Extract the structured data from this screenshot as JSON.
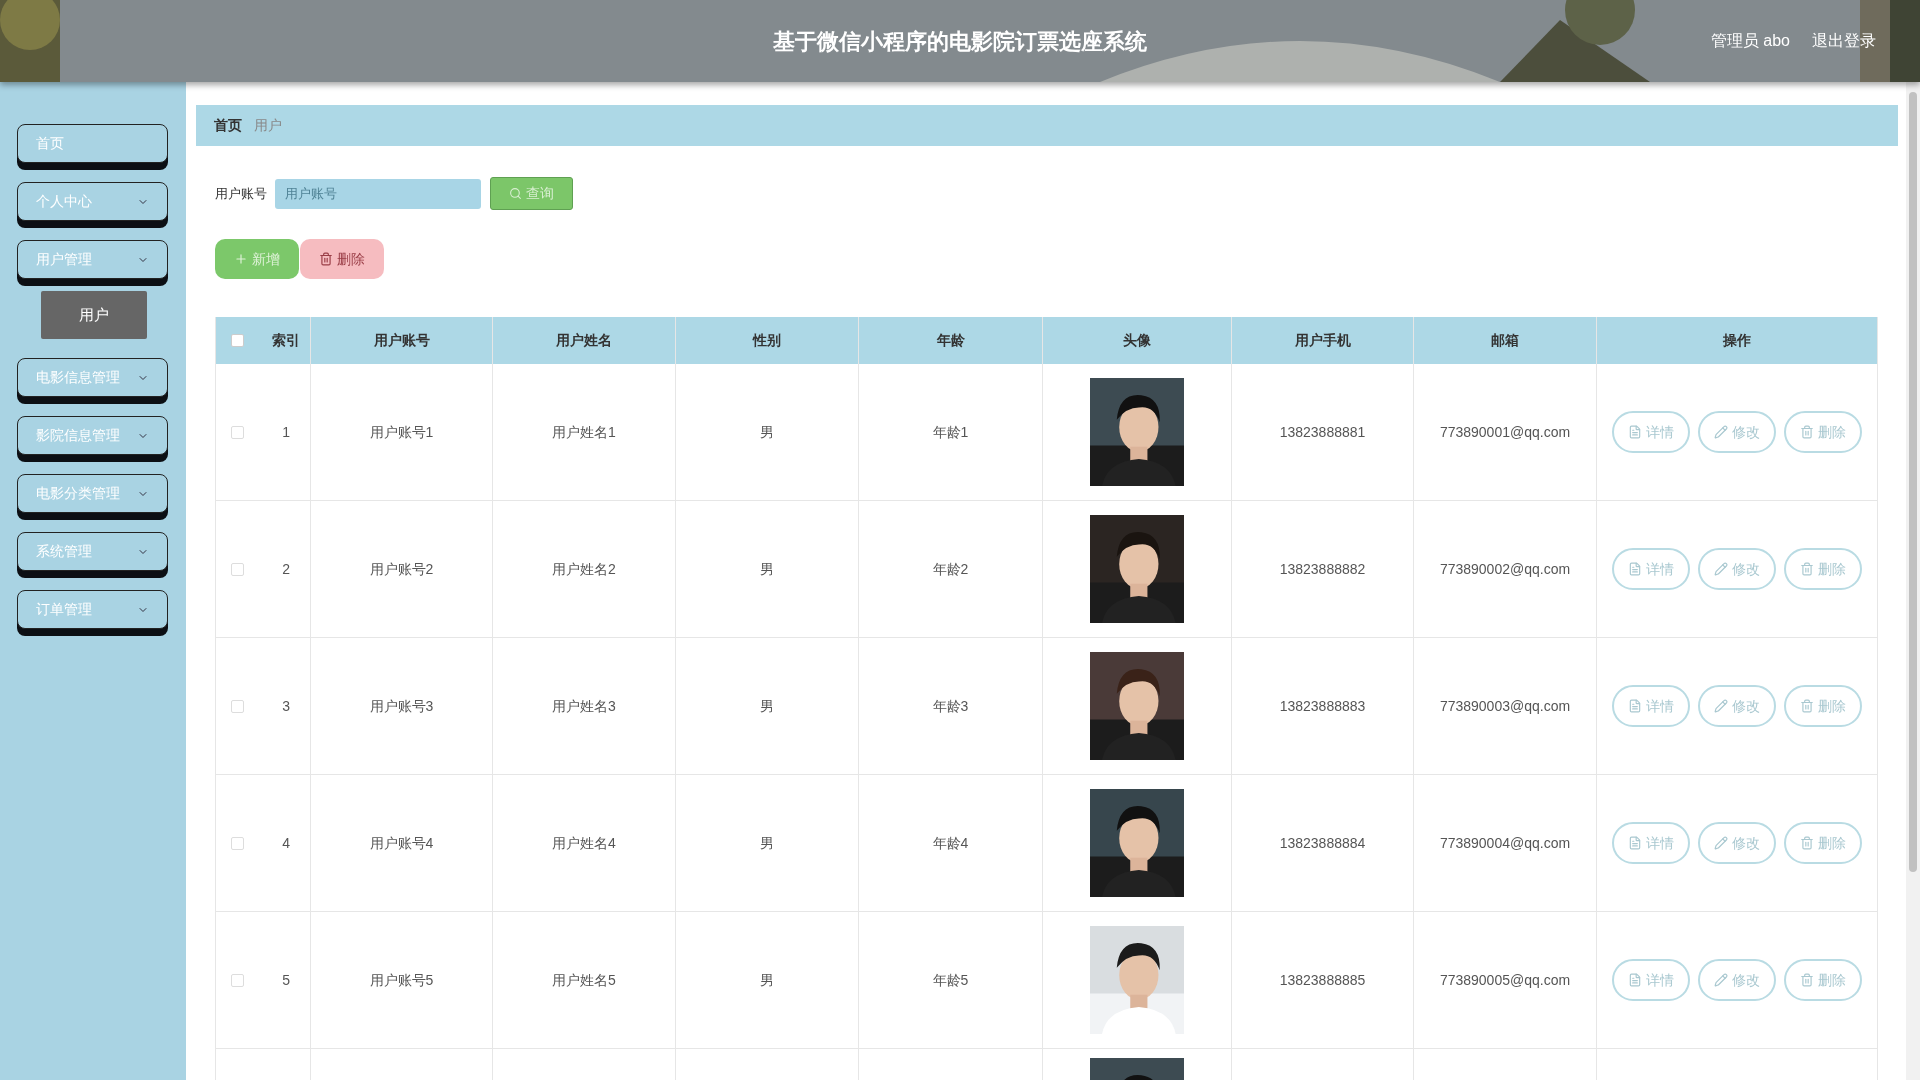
{
  "header": {
    "title": "基于微信小程序的电影院订票选座系统",
    "user": "管理员 abo",
    "logout": "退出登录"
  },
  "sidebar": {
    "items": [
      {
        "kind": "link",
        "label": "首页"
      },
      {
        "kind": "group",
        "label": "个人中心"
      },
      {
        "kind": "group",
        "label": "用户管理",
        "children": [
          {
            "label": "用户",
            "selected": true
          }
        ]
      },
      {
        "kind": "group",
        "label": "电影信息管理"
      },
      {
        "kind": "group",
        "label": "影院信息管理"
      },
      {
        "kind": "group",
        "label": "电影分类管理"
      },
      {
        "kind": "group",
        "label": "系统管理"
      },
      {
        "kind": "group",
        "label": "订单管理"
      }
    ]
  },
  "breadcrumb": [
    "首页",
    "用户"
  ],
  "search": {
    "label": "用户账号",
    "placeholder": "用户账号",
    "button": "查询"
  },
  "actions": [
    {
      "kind": "add",
      "label": "新增"
    },
    {
      "kind": "delete",
      "label": "删除"
    }
  ],
  "table": {
    "header_checkbox": {
      "checked": false
    },
    "columns": [
      "索引",
      "用户账号",
      "用户姓名",
      "性别",
      "年龄",
      "头像",
      "用户手机",
      "邮箱",
      "操作"
    ],
    "rows": [
      {
        "checked": false,
        "index": "1",
        "account": "用户账号1",
        "name": "用户姓名1",
        "gender": "男",
        "age": "年龄1",
        "phone": "13823888881",
        "email": "773890001@qq.com",
        "actions": [
          {
            "kind": "detail",
            "label": "详情"
          },
          {
            "kind": "edit",
            "label": "修改"
          },
          {
            "kind": "delete",
            "label": "删除"
          }
        ]
      },
      {
        "checked": false,
        "index": "2",
        "account": "用户账号2",
        "name": "用户姓名2",
        "gender": "男",
        "age": "年龄2",
        "phone": "13823888882",
        "email": "773890002@qq.com",
        "actions": [
          {
            "kind": "detail",
            "label": "详情"
          },
          {
            "kind": "edit",
            "label": "修改"
          },
          {
            "kind": "delete",
            "label": "删除"
          }
        ]
      },
      {
        "checked": false,
        "index": "3",
        "account": "用户账号3",
        "name": "用户姓名3",
        "gender": "男",
        "age": "年龄3",
        "phone": "13823888883",
        "email": "773890003@qq.com",
        "actions": [
          {
            "kind": "detail",
            "label": "详情"
          },
          {
            "kind": "edit",
            "label": "修改"
          },
          {
            "kind": "delete",
            "label": "删除"
          }
        ]
      },
      {
        "checked": false,
        "index": "4",
        "account": "用户账号4",
        "name": "用户姓名4",
        "gender": "男",
        "age": "年龄4",
        "phone": "13823888884",
        "email": "773890004@qq.com",
        "actions": [
          {
            "kind": "detail",
            "label": "详情"
          },
          {
            "kind": "edit",
            "label": "修改"
          },
          {
            "kind": "delete",
            "label": "删除"
          }
        ]
      },
      {
        "checked": false,
        "index": "5",
        "account": "用户账号5",
        "name": "用户姓名5",
        "gender": "男",
        "age": "年龄5",
        "phone": "13823888885",
        "email": "773890005@qq.com",
        "actions": [
          {
            "kind": "detail",
            "label": "详情"
          },
          {
            "kind": "edit",
            "label": "修改"
          },
          {
            "kind": "delete",
            "label": "删除"
          }
        ]
      }
    ]
  }
}
